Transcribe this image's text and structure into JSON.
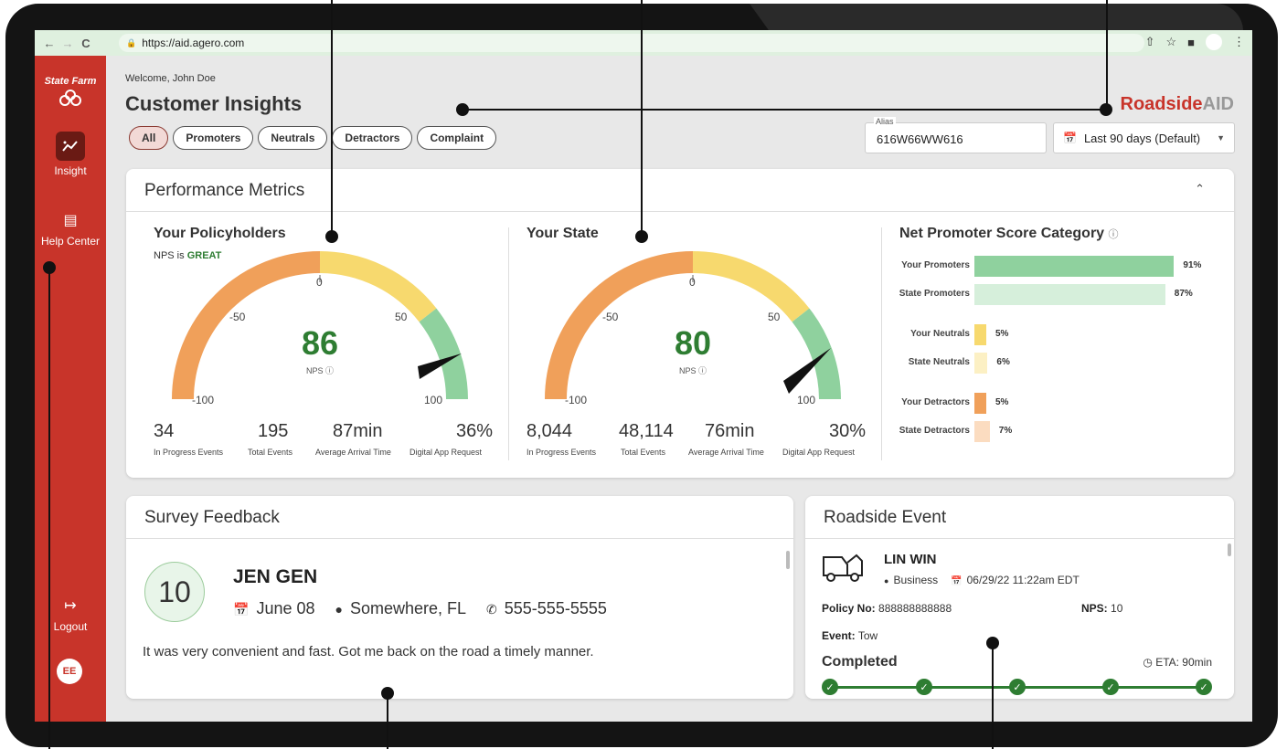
{
  "browser": {
    "url": "https://aid.agero.com",
    "back": "←",
    "forward": "→",
    "reload": "C"
  },
  "sidebar": {
    "brand": "State Farm",
    "items": [
      {
        "label": "Insight",
        "icon": "insight-icon"
      },
      {
        "label": "Help Center",
        "icon": "help-center-icon"
      }
    ],
    "logout": "Logout",
    "avatar": "EE"
  },
  "header": {
    "welcome": "Welcome, John Doe",
    "title": "Customer Insights",
    "logo_main": "Roadside",
    "logo_accent": "AID"
  },
  "filters": {
    "chips": [
      "All",
      "Promoters",
      "Neutrals",
      "Detractors",
      "Complaint"
    ],
    "active": "All"
  },
  "alias": {
    "label": "Alias",
    "value": "616W66WW616"
  },
  "date_range": {
    "value": "Last 90 days (Default)"
  },
  "performance": {
    "title": "Performance Metrics",
    "policyholders": {
      "title": "Your Policyholders",
      "status_prefix": "NPS is",
      "status": "GREAT",
      "nps": "86",
      "nps_label": "NPS ⓘ",
      "ticks": [
        "-100",
        "-50",
        "0",
        "50",
        "100"
      ],
      "stats": [
        {
          "value": "34",
          "label": "In Progress Events"
        },
        {
          "value": "195",
          "label": "Total Events"
        },
        {
          "value": "87min",
          "label": "Average Arrival Time"
        },
        {
          "value": "36%",
          "label": "Digital App Request"
        }
      ]
    },
    "state": {
      "title": "Your State",
      "nps": "80",
      "nps_label": "NPS ⓘ",
      "ticks": [
        "-100",
        "-50",
        "0",
        "50",
        "100"
      ],
      "stats": [
        {
          "value": "8,044",
          "label": "In Progress Events"
        },
        {
          "value": "48,114",
          "label": "Total Events"
        },
        {
          "value": "76min",
          "label": "Average Arrival Time"
        },
        {
          "value": "30%",
          "label": "Digital App Request"
        }
      ]
    },
    "nps_category": {
      "title": "Net Promoter Score Category",
      "rows": [
        {
          "label": "Your Promoters",
          "pct": "91%",
          "value": 91,
          "color": "#8fd19e"
        },
        {
          "label": "State Promoters",
          "pct": "87%",
          "value": 87,
          "color": "#d6efdb"
        },
        {
          "label": "Your Neutrals",
          "pct": "5%",
          "value": 5,
          "color": "#f7d96e"
        },
        {
          "label": "State Neutrals",
          "pct": "6%",
          "value": 6,
          "color": "#fcf0c4"
        },
        {
          "label": "Your Detractors",
          "pct": "5%",
          "value": 5,
          "color": "#f0a05a"
        },
        {
          "label": "State Detractors",
          "pct": "7%",
          "value": 7,
          "color": "#fbdcc0"
        }
      ]
    }
  },
  "survey": {
    "title": "Survey Feedback",
    "score": "10",
    "name": "JEN GEN",
    "date": "June 08",
    "location": "Somewhere, FL",
    "phone": "555-555-5555",
    "comment": "It was very convenient and fast. Got me back on the road a timely manner."
  },
  "roadside": {
    "title": "Roadside Event",
    "name": "LIN WIN",
    "type": "Business",
    "datetime": "06/29/22 11:22am EDT",
    "policy_label": "Policy No:",
    "policy_no": "888888888888",
    "nps_label": "NPS:",
    "nps": "10",
    "event_label": "Event:",
    "event": "Tow",
    "status": "Completed",
    "eta": "ETA: 90min"
  },
  "colors": {
    "brand_red": "#c8342a",
    "nps_green": "#2e7d32",
    "gauge_orange": "#f0a05a",
    "gauge_yellow": "#f7d96e",
    "gauge_green": "#8fd19e"
  }
}
